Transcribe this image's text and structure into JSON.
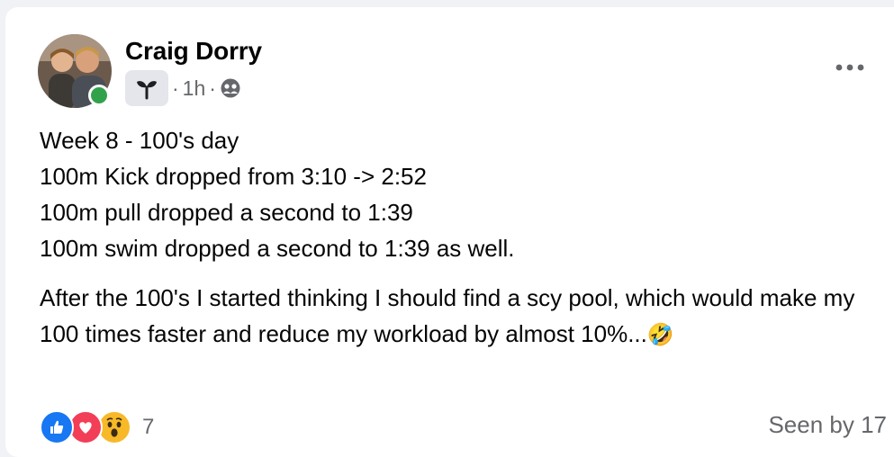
{
  "post": {
    "author": "Craig Dorry",
    "time": "1h",
    "separator": "·",
    "paragraph1_lines": [
      "Week 8 - 100's day",
      "100m Kick dropped from 3:10 -> 2:52",
      "100m pull dropped a second to 1:39",
      "100m swim dropped a second to 1:39 as well."
    ],
    "paragraph2": "After the 100's I started thinking I should find a scy pool, which would make my 100 times faster and reduce my workload by almost 10%...",
    "paragraph2_emoji": "🤣"
  },
  "icons": {
    "group": "sprout-icon",
    "audience": "friends-icon",
    "more": "more-options-icon",
    "reactions": [
      "like-icon",
      "love-icon",
      "wow-icon"
    ]
  },
  "footer": {
    "reaction_count": "7",
    "seen_by": "Seen by 17"
  },
  "colors": {
    "online": "#31a24c",
    "like": "#1877f2",
    "love": "#f33e58",
    "wow": "#f7b928",
    "secondary_text": "#65676b"
  }
}
